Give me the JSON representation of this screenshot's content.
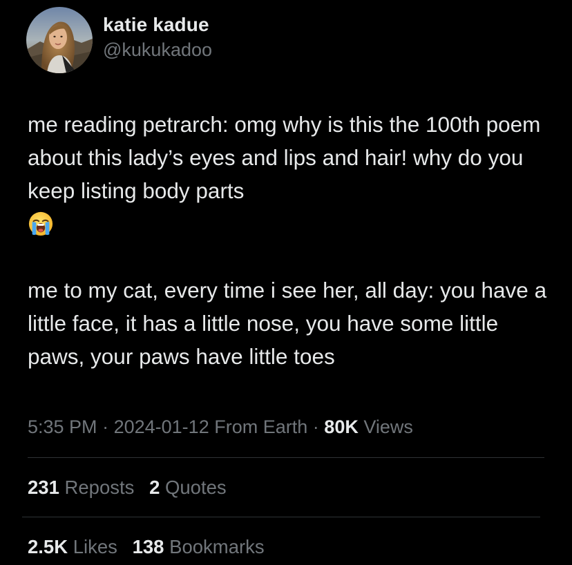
{
  "author": {
    "display_name": "katie kadue",
    "handle": "@kukukadoo",
    "avatar_icon": "profile-photo"
  },
  "body": {
    "paragraph1": "me reading petrarch: omg why is this the 100th poem about this lady’s eyes and lips and hair! why do you keep listing body parts",
    "paragraph1_emoji": "loudly-crying-face-emoji",
    "paragraph2": "me to my cat, every time i see her, all day: you have a little face, it has a little nose, you have some little paws, your paws have little toes"
  },
  "meta": {
    "time": "5:35 PM",
    "separator": "·",
    "date": "2024-01-12",
    "source": "From Earth",
    "views_count": "80K",
    "views_label": "Views"
  },
  "stats": {
    "reposts_count": "231",
    "reposts_label": "Reposts",
    "quotes_count": "2",
    "quotes_label": "Quotes",
    "likes_count": "2.5K",
    "likes_label": "Likes",
    "bookmarks_count": "138",
    "bookmarks_label": "Bookmarks"
  },
  "colors": {
    "background": "#000000",
    "primary_text": "#e7e9ea",
    "secondary_text": "#71767b",
    "divider": "#2f3336"
  }
}
